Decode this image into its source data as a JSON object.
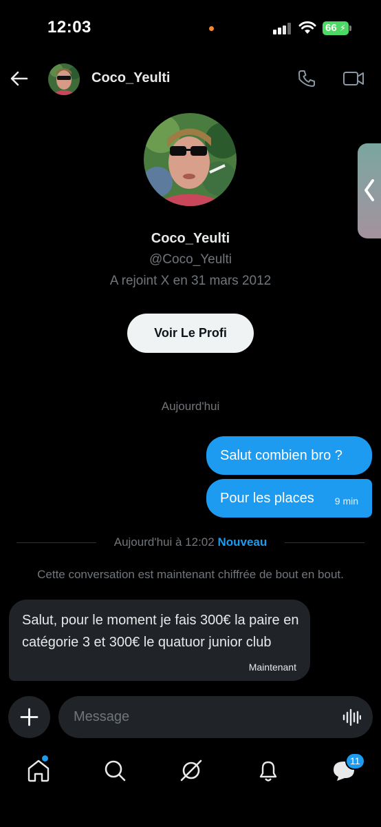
{
  "status_bar": {
    "time": "12:03",
    "battery": "66"
  },
  "header": {
    "name": "Coco_Yeulti"
  },
  "profile": {
    "name": "Coco_Yeulti",
    "handle": "@Coco_Yeulti",
    "joined": "A rejoint X en 31 mars 2012",
    "view_button": "Voir Le Profi"
  },
  "messages": {
    "day_separator": "Aujourd'hui",
    "outgoing": [
      {
        "text": "Salut combien bro ?"
      },
      {
        "text": "Pour les places",
        "time": "9 min"
      }
    ],
    "new_separator": {
      "text": "Aujourd'hui à 12:02",
      "new_label": "Nouveau"
    },
    "encryption_note": "Cette conversation est maintenant chiffrée de bout en bout.",
    "incoming": {
      "text": "Salut, pour le moment je fais 300€ la paire en catégorie 3 et 300€ le quatuor junior club",
      "time": "Maintenant"
    }
  },
  "composer": {
    "placeholder": "Message"
  },
  "tabbar": {
    "messages_badge": "11"
  },
  "colors": {
    "accent": "#1d9bf0",
    "background": "#000000",
    "bubble_in": "#202327"
  }
}
